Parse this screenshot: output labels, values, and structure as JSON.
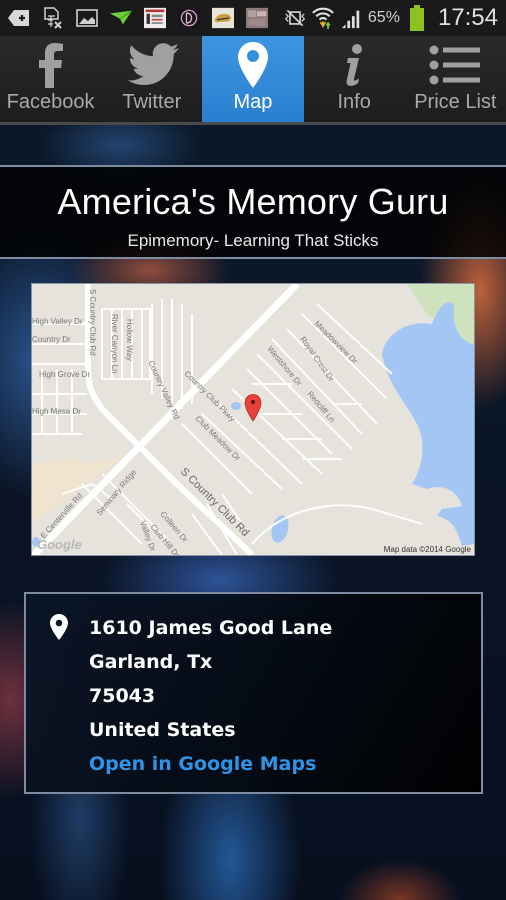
{
  "status_bar": {
    "notification_icons": [
      "add-icon",
      "spreadsheet-x-icon",
      "image-icon",
      "paper-plane-icon",
      "app-thumbnail-1",
      "app-thumbnail-2",
      "app-thumbnail-3",
      "app-thumbnail-4"
    ],
    "system_icons": [
      "mute-vibrate-icon",
      "wifi-icon",
      "signal-icon",
      "battery-icon"
    ],
    "battery_percent": "65%",
    "time": "17:54",
    "battery_color": "#8dc21f"
  },
  "tabs": [
    {
      "label": "Facebook",
      "icon": "facebook-icon",
      "active": false
    },
    {
      "label": "Twitter",
      "icon": "twitter-icon",
      "active": false
    },
    {
      "label": "Map",
      "icon": "map-pin-icon",
      "active": true
    },
    {
      "label": "Info",
      "icon": "info-icon",
      "active": false
    },
    {
      "label": "Price List",
      "icon": "list-icon",
      "active": false
    }
  ],
  "header": {
    "title": "America's Memory Guru",
    "subtitle": "Epimemory- Learning That Sticks"
  },
  "map": {
    "attribution": "Map data ©2014 Google",
    "logo": "Google",
    "street_labels": [
      "S Country Club Rd",
      "High Valley Dr",
      "Country Dr",
      "High Grove Dr",
      "High Mesa Dr",
      "River Canyon Ln",
      "Hollow Way",
      "Country Valley Rd",
      "Country Club Pkwy",
      "Club Meadow Dr",
      "Westshore Dr",
      "Royal Crest Dr",
      "Meadowview Dr",
      "Redcliff Ln",
      "E Centerville Rd",
      "Seminary Ridge",
      "Colleen Dr",
      "Club Hill Dr",
      "Valley Dr"
    ]
  },
  "address": {
    "line1": "1610 James Good Lane",
    "line2": "Garland, Tx",
    "line3": "75043",
    "line4": "United States",
    "link": "Open in Google Maps"
  },
  "colors": {
    "accent": "#2f93e8",
    "active_tab": "#3490dd",
    "pin": "#e8413a",
    "water": "#a3c6f5",
    "park": "#c9dfb9"
  }
}
